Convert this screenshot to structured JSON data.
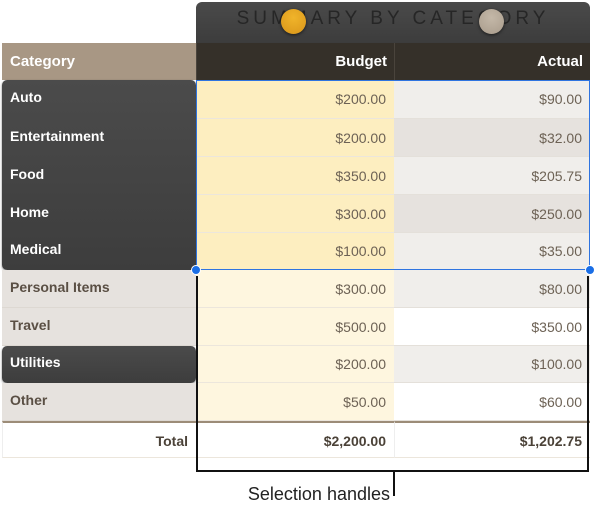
{
  "title": "SUMMARY BY CATEGORY",
  "headers": {
    "category": "Category",
    "budget": "Budget",
    "actual": "Actual"
  },
  "rows": [
    {
      "category": "Auto",
      "budget": "$200.00",
      "actual": "$90.00"
    },
    {
      "category": "Entertainment",
      "budget": "$200.00",
      "actual": "$32.00"
    },
    {
      "category": "Food",
      "budget": "$350.00",
      "actual": "$205.75"
    },
    {
      "category": "Home",
      "budget": "$300.00",
      "actual": "$250.00"
    },
    {
      "category": "Medical",
      "budget": "$100.00",
      "actual": "$35.00"
    },
    {
      "category": "Personal Items",
      "budget": "$300.00",
      "actual": "$80.00"
    },
    {
      "category": "Travel",
      "budget": "$500.00",
      "actual": "$350.00"
    },
    {
      "category": "Utilities",
      "budget": "$200.00",
      "actual": "$100.00"
    },
    {
      "category": "Other",
      "budget": "$50.00",
      "actual": "$60.00"
    }
  ],
  "total": {
    "label": "Total",
    "budget": "$2,200.00",
    "actual": "$1,202.75"
  },
  "callout": "Selection handles",
  "colors": {
    "selection": "#2f74e0",
    "header_dark": "#353029",
    "category_header": "#a89784",
    "budget_selected": "#fdeec0",
    "budget": "#fef6df"
  }
}
